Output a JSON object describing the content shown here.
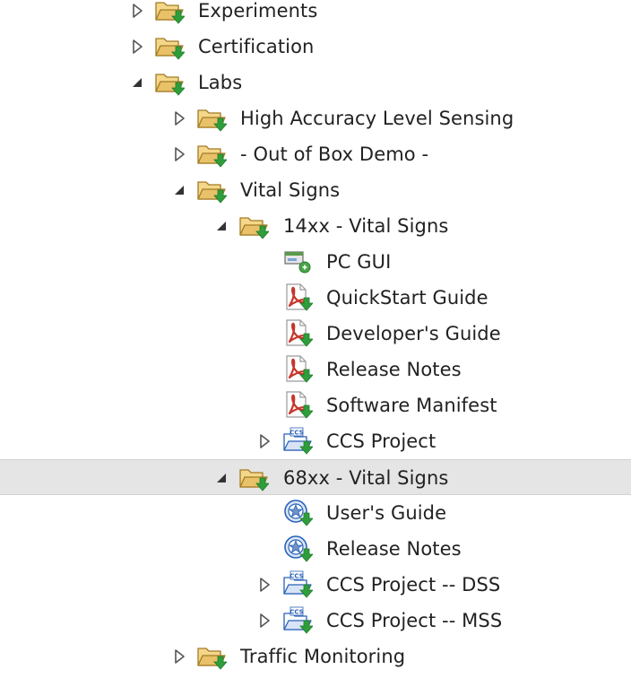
{
  "tree": {
    "items": [
      {
        "label": "Experiments",
        "icon": "folder-download-icon",
        "twisty": "collapsed",
        "level": 0
      },
      {
        "label": "Certification",
        "icon": "folder-download-icon",
        "twisty": "collapsed",
        "level": 0
      },
      {
        "label": "Labs",
        "icon": "folder-download-icon",
        "twisty": "expanded",
        "level": 0
      },
      {
        "label": "High Accuracy Level Sensing",
        "icon": "folder-download-icon",
        "twisty": "collapsed",
        "level": 1
      },
      {
        "label": "- Out of Box Demo -",
        "icon": "folder-download-icon",
        "twisty": "collapsed",
        "level": 1
      },
      {
        "label": "Vital Signs",
        "icon": "folder-download-icon",
        "twisty": "expanded",
        "level": 1
      },
      {
        "label": "14xx - Vital Signs",
        "icon": "folder-download-icon",
        "twisty": "expanded",
        "level": 2
      },
      {
        "label": "PC GUI",
        "icon": "gui-app-icon",
        "twisty": "none",
        "level": 3
      },
      {
        "label": "QuickStart Guide",
        "icon": "pdf-download-icon",
        "twisty": "none",
        "level": 3
      },
      {
        "label": "Developer's Guide",
        "icon": "pdf-download-icon",
        "twisty": "none",
        "level": 3
      },
      {
        "label": "Release Notes",
        "icon": "pdf-download-icon",
        "twisty": "none",
        "level": 3
      },
      {
        "label": "Software Manifest",
        "icon": "pdf-download-icon",
        "twisty": "none",
        "level": 3
      },
      {
        "label": "CCS Project",
        "icon": "ccs-project-icon",
        "twisty": "collapsed",
        "level": 3
      },
      {
        "label": "68xx - Vital Signs",
        "icon": "folder-download-icon",
        "twisty": "expanded",
        "level": 2,
        "selected": true
      },
      {
        "label": "User's Guide",
        "icon": "web-document-icon",
        "twisty": "none",
        "level": 3
      },
      {
        "label": "Release Notes",
        "icon": "web-document-icon",
        "twisty": "none",
        "level": 3
      },
      {
        "label": "CCS Project -- DSS",
        "icon": "ccs-project-icon",
        "twisty": "collapsed",
        "level": 3
      },
      {
        "label": "CCS Project -- MSS",
        "icon": "ccs-project-icon",
        "twisty": "collapsed",
        "level": 3
      },
      {
        "label": "Traffic Monitoring",
        "icon": "folder-download-icon",
        "twisty": "collapsed",
        "level": 1
      }
    ]
  },
  "colors": {
    "folder": "#e8c168",
    "folder_stroke": "#a27b24",
    "download_arrow": "#2e9e3a",
    "pdf_red": "#c8352b",
    "ccs_blue": "#2a62b8",
    "selection": "#e5e5e5",
    "twisty": "#555555"
  }
}
